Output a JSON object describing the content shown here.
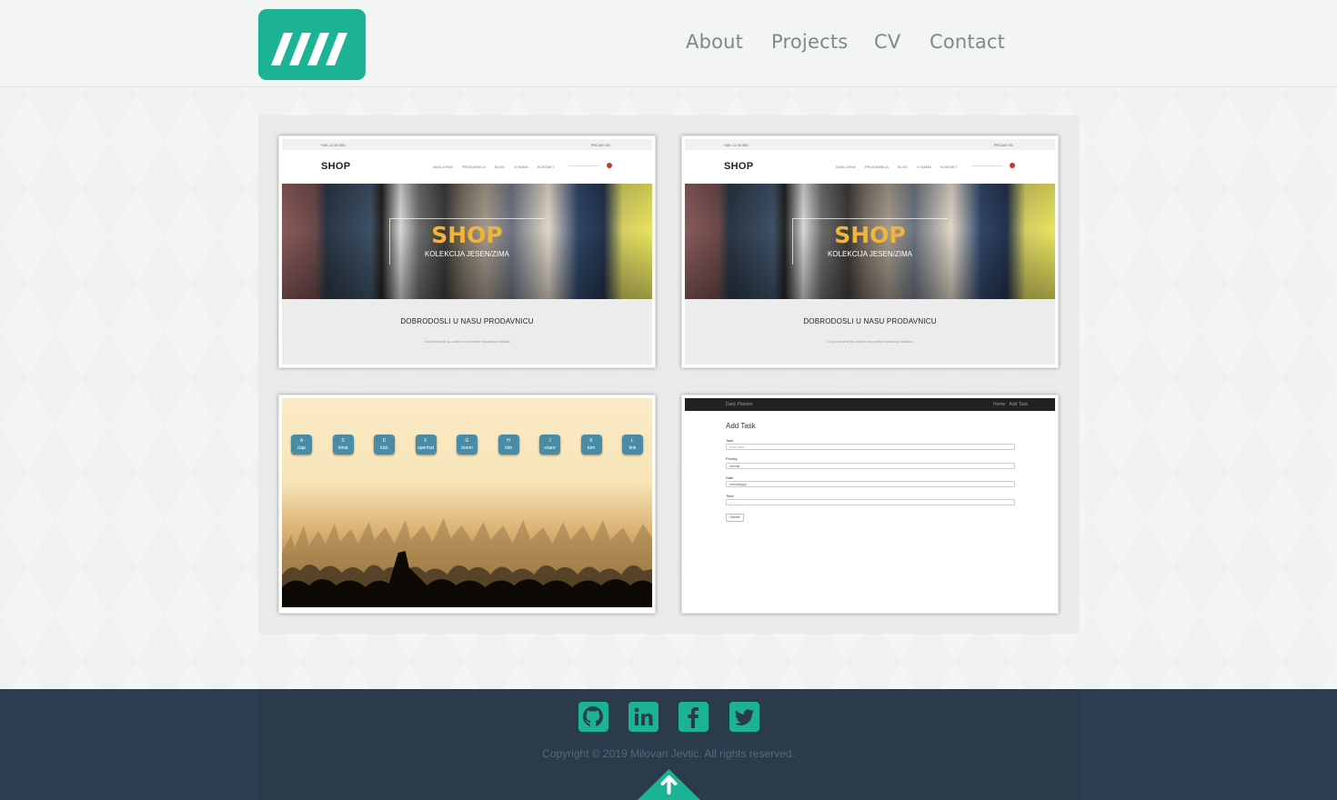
{
  "nav": {
    "about": "About",
    "projects": "Projects",
    "cv": "CV",
    "contact": "Contact"
  },
  "colors": {
    "accent": "#1bb394",
    "footer": "#2c3e50",
    "nav_text": "#7d8a8b"
  },
  "projects": {
    "shop": {
      "phone": "+381 11 55 555",
      "cart": "PRIJAVI SE",
      "brand": "SHOP",
      "links": [
        "NASLOVNA",
        "PRODAVNICA",
        "BLOG",
        "O NAMA",
        "KONTAKT"
      ],
      "hero_title": "SHOP",
      "hero_subtitle": "KOLEKCIJA JESEN/ZIMA",
      "welcome_title": "DOBRODOSLI U NASU PRODAVNICU",
      "welcome_text": "Ovaj template je urađen za potrebe školskog zadatka"
    },
    "drum_kit": {
      "keys": [
        {
          "letter": "A",
          "sound": "clap"
        },
        {
          "letter": "S",
          "sound": "hihat"
        },
        {
          "letter": "D",
          "sound": "kick"
        },
        {
          "letter": "F",
          "sound": "openhat"
        },
        {
          "letter": "G",
          "sound": "boom"
        },
        {
          "letter": "H",
          "sound": "ride"
        },
        {
          "letter": "J",
          "sound": "snare"
        },
        {
          "letter": "K",
          "sound": "tom"
        },
        {
          "letter": "L",
          "sound": "tink"
        }
      ]
    },
    "planner": {
      "app_name": "Daily Planner",
      "links": [
        "Home",
        "Add Task"
      ],
      "title": "Add Task",
      "task_label": "Task",
      "task_placeholder": "Enter task",
      "priority_label": "Priority",
      "priority_value": "Normal",
      "date_label": "Date",
      "date_value": "mm/dd/yyyy",
      "time_label": "Time",
      "time_placeholder": "--:-- --",
      "submit": "Submit"
    }
  },
  "footer": {
    "social": [
      "github-icon",
      "linkedin-icon",
      "facebook-icon",
      "twitter-icon"
    ],
    "copyright": "Copyright © 2019 Milovan Jevtic. All rights reserved."
  }
}
